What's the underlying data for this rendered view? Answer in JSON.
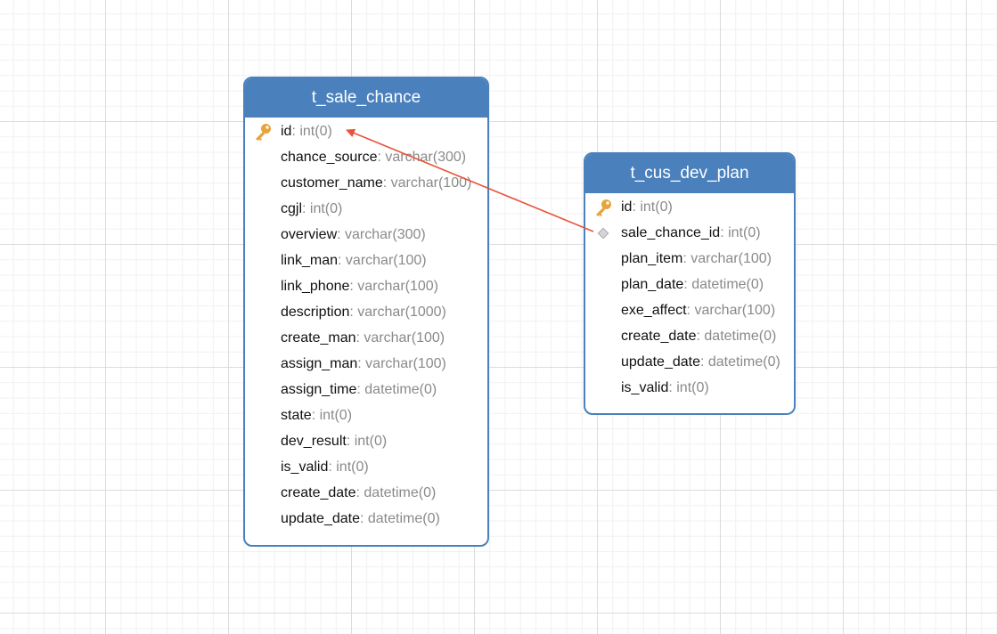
{
  "tables": [
    {
      "name": "t_sale_chance",
      "fields": [
        {
          "name": "id",
          "type": ": int(0)",
          "icon": "primary-key-icon"
        },
        {
          "name": "chance_source",
          "type": ": varchar(300)"
        },
        {
          "name": "customer_name",
          "type": ": varchar(100)"
        },
        {
          "name": "cgjl",
          "type": ": int(0)"
        },
        {
          "name": "overview",
          "type": ": varchar(300)"
        },
        {
          "name": "link_man",
          "type": ": varchar(100)"
        },
        {
          "name": "link_phone",
          "type": ": varchar(100)"
        },
        {
          "name": "description",
          "type": ": varchar(1000)"
        },
        {
          "name": "create_man",
          "type": ": varchar(100)"
        },
        {
          "name": "assign_man",
          "type": ": varchar(100)"
        },
        {
          "name": "assign_time",
          "type": ": datetime(0)"
        },
        {
          "name": "state",
          "type": ": int(0)"
        },
        {
          "name": "dev_result",
          "type": ": int(0)"
        },
        {
          "name": "is_valid",
          "type": ": int(0)"
        },
        {
          "name": "create_date",
          "type": ": datetime(0)"
        },
        {
          "name": "update_date",
          "type": ": datetime(0)"
        }
      ]
    },
    {
      "name": "t_cus_dev_plan",
      "fields": [
        {
          "name": "id",
          "type": ": int(0)",
          "icon": "primary-key-icon"
        },
        {
          "name": "sale_chance_id",
          "type": ": int(0)",
          "icon": "foreign-key-icon"
        },
        {
          "name": "plan_item",
          "type": ": varchar(100)"
        },
        {
          "name": "plan_date",
          "type": ": datetime(0)"
        },
        {
          "name": "exe_affect",
          "type": ": varchar(100)"
        },
        {
          "name": "create_date",
          "type": ": datetime(0)"
        },
        {
          "name": "update_date",
          "type": ": datetime(0)"
        },
        {
          "name": "is_valid",
          "type": ": int(0)"
        }
      ]
    }
  ],
  "relations": [
    {
      "from": "t_cus_dev_plan.sale_chance_id",
      "to": "t_sale_chance.id"
    }
  ],
  "colors": {
    "header": "#4a81bd",
    "relation_line": "#e8533a",
    "key": "#e8a33a"
  }
}
